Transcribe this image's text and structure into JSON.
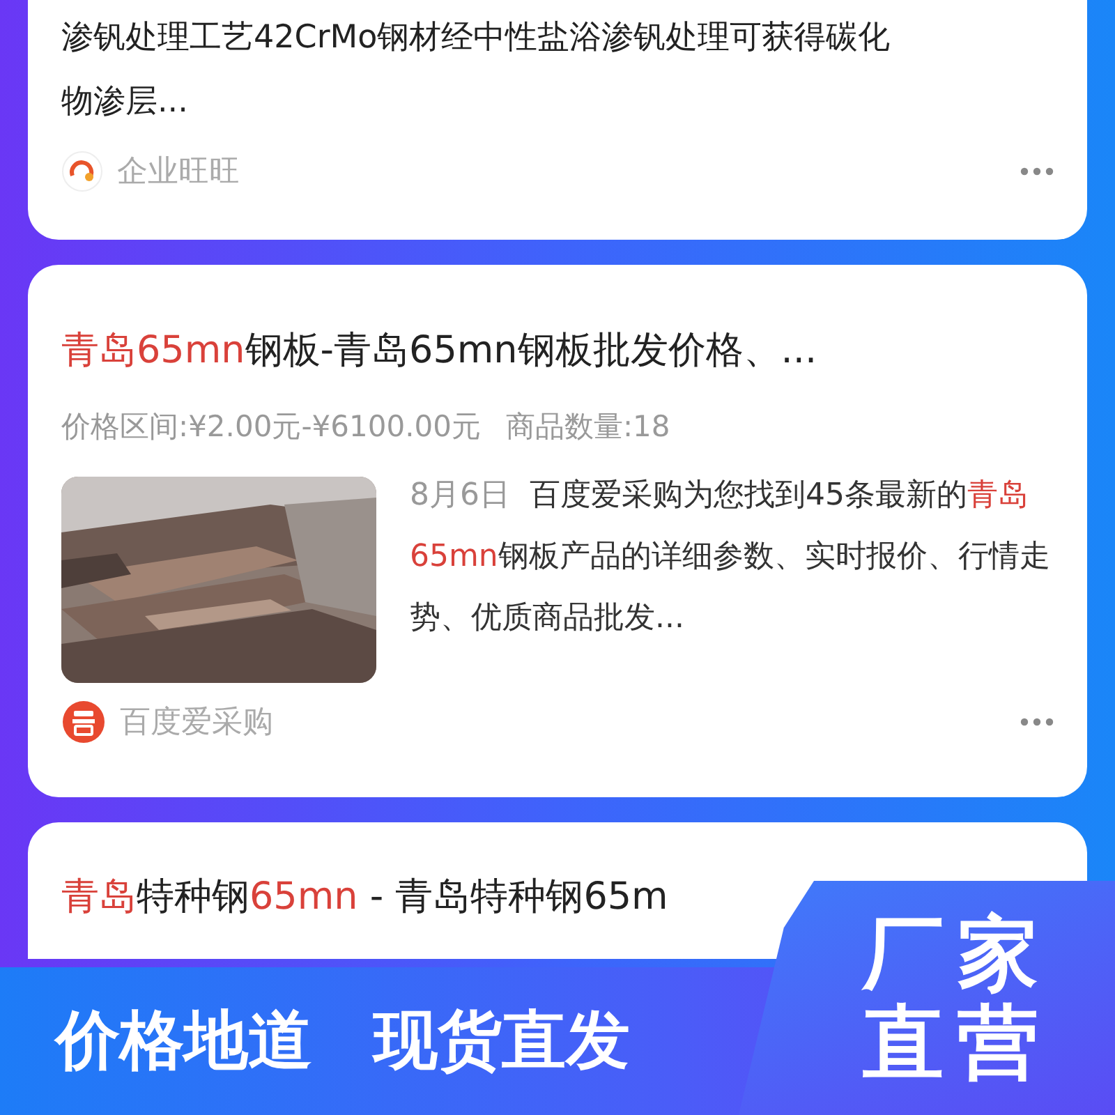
{
  "cards": [
    {
      "kind": "snippet",
      "lines": [
        "渗钒处理工艺42CrMo钢材经中性盐浴渗钒处理可获得碳化",
        "物渗层..."
      ],
      "source": "企业旺旺"
    },
    {
      "kind": "product",
      "title": [
        {
          "text": "青岛65mn",
          "highlight": true
        },
        {
          "text": "钢板-青岛65mn钢板批发价格、...",
          "highlight": false
        }
      ],
      "price": "价格区间:¥2.00元-¥6100.00元",
      "count": "商品数量:18",
      "date": "8月6日",
      "description": [
        {
          "text": "百度爱采购为您找到45条最新的",
          "highlight": false
        },
        {
          "text": "青岛65mn",
          "highlight": true
        },
        {
          "text": "钢板产品的详细参数、实时报价、行情走势、优质商品批发...",
          "highlight": false
        }
      ],
      "source": "百度爱采购"
    },
    {
      "kind": "title_only",
      "title": [
        {
          "text": "青岛",
          "highlight": true
        },
        {
          "text": "特种钢",
          "highlight": false
        },
        {
          "text": "65mn",
          "highlight": true
        },
        {
          "text": " - 青岛特种钢65m",
          "highlight": false
        }
      ]
    }
  ],
  "banner": {
    "slogans": [
      "价格地道",
      "现货直发"
    ],
    "badge_lines": [
      "厂家",
      "直营"
    ]
  }
}
